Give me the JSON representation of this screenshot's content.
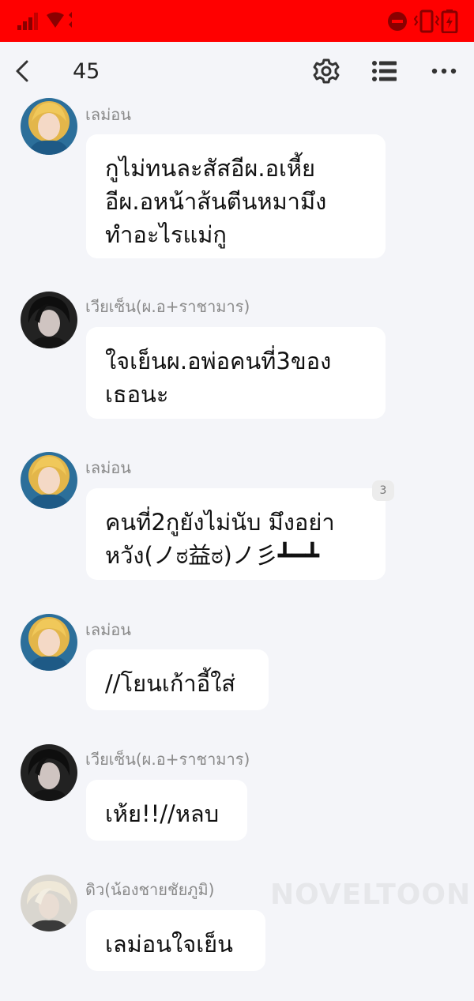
{
  "status_bar": {
    "color": "#ff0000",
    "icons": [
      "signal-icon",
      "wifi-icon",
      "do-not-disturb-icon",
      "vibrate-icon",
      "battery-icon"
    ]
  },
  "nav": {
    "title": "45",
    "icons": [
      "back-icon",
      "gear-icon",
      "list-icon",
      "more-icon"
    ]
  },
  "messages": [
    {
      "sender": "เลม่อน",
      "text": "กูไม่ทนละสัสอีผ.อเหี้ย\nอีผ.อหน้าส้นตีนหมามึง\nทำอะไรแม่กู"
    },
    {
      "sender": "เวียเซ็น(ผ.อ+ราชามาร)",
      "text": "ใจเย็นผ.อพ่อคนที่3ของ\nเธอนะ"
    },
    {
      "sender": "เลม่อน",
      "text": "คนที่2กูยังไม่นับ มึงอย่า\nหวัง(ノಠ益ಠ)ノ彡┻━┻",
      "badge": "3"
    },
    {
      "sender": "เลม่อน",
      "text": "//โยนเก้าอี้ใส่"
    },
    {
      "sender": "เวียเซ็น(ผ.อ+ราชามาร)",
      "text": "เห้ย!!//หลบ"
    },
    {
      "sender": "ดิว(น้องชายชัยภูมิ)",
      "text": "เลม่อนใจเย็น"
    }
  ],
  "watermark": "NOVELTOON"
}
